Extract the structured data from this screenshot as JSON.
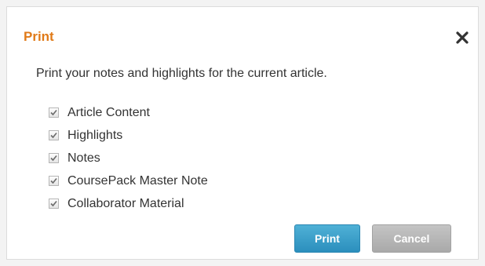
{
  "dialog": {
    "title": "Print",
    "description": "Print your notes and highlights for the current article.",
    "close_icon": "close-icon",
    "options": [
      {
        "label": "Article Content",
        "checked": true
      },
      {
        "label": "Highlights",
        "checked": true
      },
      {
        "label": "Notes",
        "checked": true
      },
      {
        "label": "CoursePack Master Note",
        "checked": true
      },
      {
        "label": "Collaborator Material",
        "checked": true
      }
    ],
    "print_label": "Print",
    "cancel_label": "Cancel"
  },
  "colors": {
    "title": "#e07a18",
    "print_button": "#3a9fca",
    "cancel_button": "#b6b6b6"
  }
}
